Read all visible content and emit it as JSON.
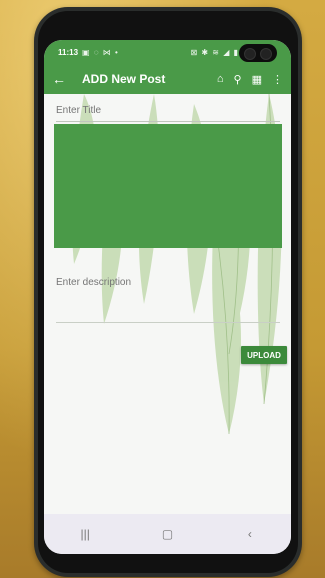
{
  "status_bar": {
    "time": "11:13",
    "left_icons": "▣ ◌ ⋈ •",
    "right_icons": "⊠ ✱ ≋ ◢ ▮"
  },
  "app_bar": {
    "back_icon": "arrow-back-icon",
    "title": "ADD New Post",
    "actions": [
      "home-icon",
      "search-icon",
      "dashboard-icon",
      "more-vert-icon"
    ],
    "color": "#4a9a48"
  },
  "form": {
    "title_placeholder": "Enter Title",
    "description_placeholder": "Enter description",
    "upload_label": "UPLOAD",
    "accent_color": "#3c8a3b"
  },
  "nav_bar": {
    "items": [
      "recent-apps-icon",
      "home-button-icon",
      "back-nav-icon"
    ]
  }
}
